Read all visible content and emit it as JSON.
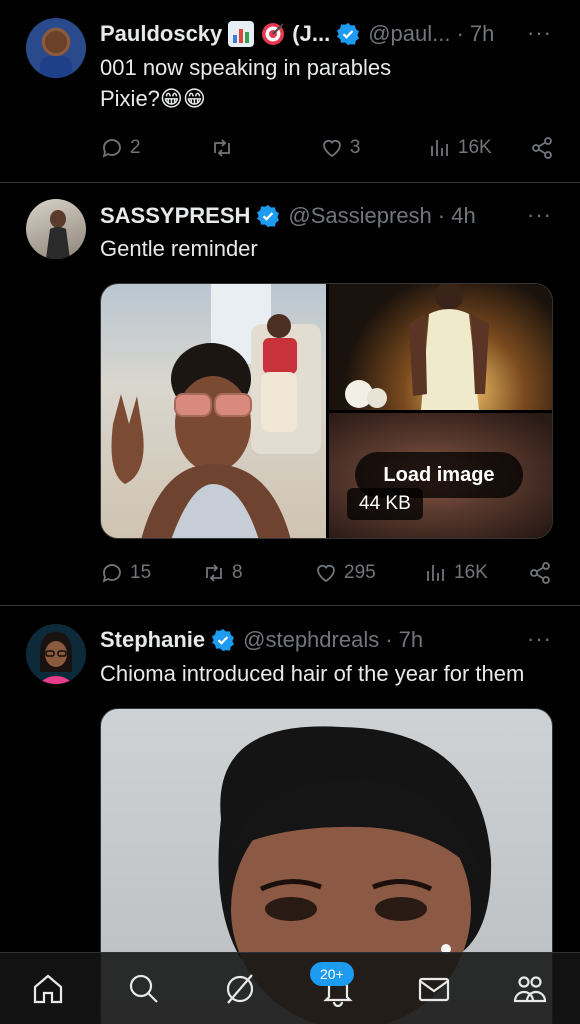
{
  "tweets": [
    {
      "name": "Pauldoscky",
      "name_suffix": "(J...",
      "handle": "@paul...",
      "time": "· 7h",
      "text_line1": "001 now speaking in parables",
      "text_line2": "Pixie?😁😁",
      "replies": "2",
      "retweets": "",
      "likes": "3",
      "views": "16K"
    },
    {
      "name": "SASSYPRESH",
      "handle": "@Sassiepresh",
      "time": "· 4h",
      "text": "Gentle reminder",
      "replies": "15",
      "retweets": "8",
      "likes": "295",
      "views": "16K",
      "load_image_label": "Load image",
      "image_size": "44 KB"
    },
    {
      "name": "Stephanie",
      "handle": "@stephdreals",
      "time": "· 7h",
      "text": "Chioma introduced hair of the year for them"
    }
  ],
  "more_icon": "···",
  "nav": {
    "items": [
      "home-icon",
      "search-icon",
      "grok-icon",
      "notifications-icon",
      "messages-icon",
      "communities-icon"
    ],
    "notification_badge": "20+"
  },
  "colors": {
    "background": "#000000",
    "verified": "#1d9bf0",
    "muted": "#71767b"
  }
}
